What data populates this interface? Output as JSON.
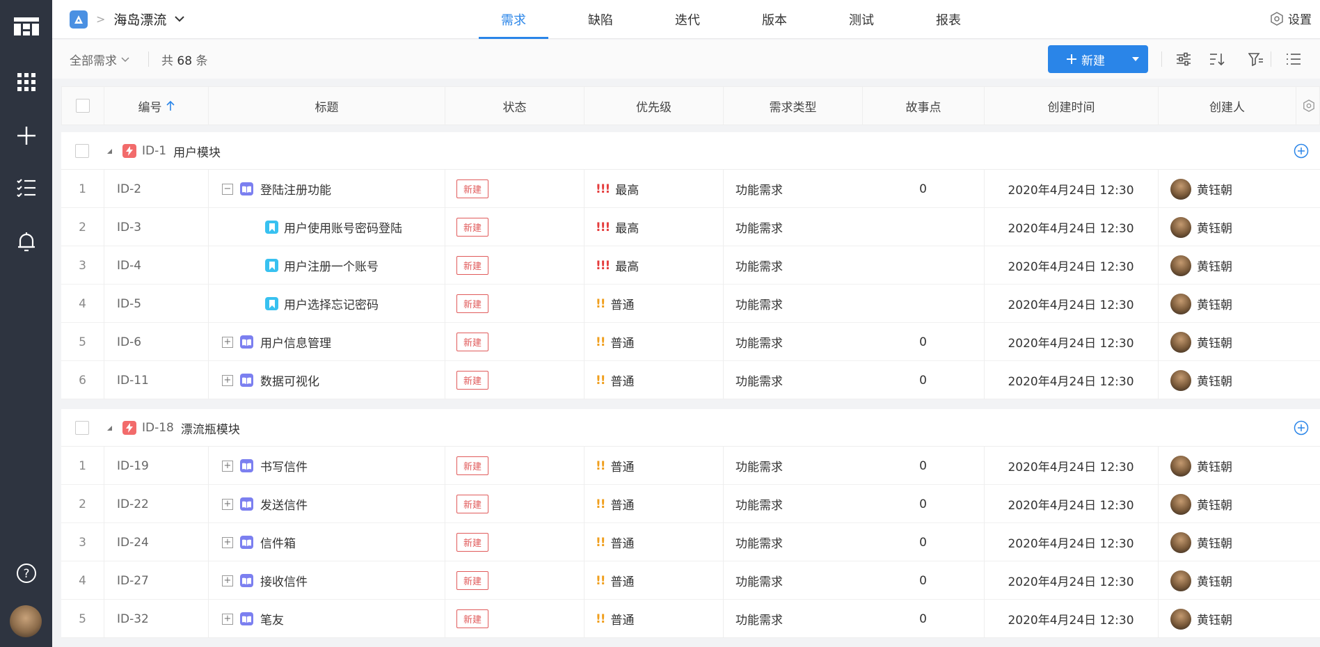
{
  "project": {
    "name": "海岛漂流"
  },
  "tabs": [
    {
      "label": "需求",
      "active": true
    },
    {
      "label": "缺陷",
      "active": false
    },
    {
      "label": "迭代",
      "active": false
    },
    {
      "label": "版本",
      "active": false
    },
    {
      "label": "测试",
      "active": false
    },
    {
      "label": "报表",
      "active": false
    }
  ],
  "settings_label": "设置",
  "toolbar": {
    "filter_label": "全部需求",
    "count_prefix": "共",
    "count_value": "68",
    "count_suffix": "条",
    "new_label": "新建"
  },
  "columns": {
    "id": "编号",
    "title": "标题",
    "status": "状态",
    "priority": "优先级",
    "type": "需求类型",
    "points": "故事点",
    "created": "创建时间",
    "creator": "创建人"
  },
  "groups": [
    {
      "id": "ID-1",
      "name": "用户模块",
      "rows": [
        {
          "idx": "1",
          "code": "ID-2",
          "title": "登陆注册功能",
          "kind": "story",
          "expander": "−",
          "indent": false,
          "status": "新建",
          "priority": "最高",
          "prio_level": "high",
          "type": "功能需求",
          "points": "0",
          "created": "2020年4月24日 12:30",
          "creator": "黄钰朝"
        },
        {
          "idx": "2",
          "code": "ID-3",
          "title": "用户使用账号密码登陆",
          "kind": "task",
          "expander": "",
          "indent": true,
          "status": "新建",
          "priority": "最高",
          "prio_level": "high",
          "type": "功能需求",
          "points": "",
          "created": "2020年4月24日 12:30",
          "creator": "黄钰朝"
        },
        {
          "idx": "3",
          "code": "ID-4",
          "title": "用户注册一个账号",
          "kind": "task",
          "expander": "",
          "indent": true,
          "status": "新建",
          "priority": "最高",
          "prio_level": "high",
          "type": "功能需求",
          "points": "",
          "created": "2020年4月24日 12:30",
          "creator": "黄钰朝"
        },
        {
          "idx": "4",
          "code": "ID-5",
          "title": "用户选择忘记密码",
          "kind": "task",
          "expander": "",
          "indent": true,
          "status": "新建",
          "priority": "普通",
          "prio_level": "mid",
          "type": "功能需求",
          "points": "",
          "created": "2020年4月24日 12:30",
          "creator": "黄钰朝"
        },
        {
          "idx": "5",
          "code": "ID-6",
          "title": "用户信息管理",
          "kind": "story",
          "expander": "+",
          "indent": false,
          "status": "新建",
          "priority": "普通",
          "prio_level": "mid",
          "type": "功能需求",
          "points": "0",
          "created": "2020年4月24日 12:30",
          "creator": "黄钰朝"
        },
        {
          "idx": "6",
          "code": "ID-11",
          "title": "数据可视化",
          "kind": "story",
          "expander": "+",
          "indent": false,
          "status": "新建",
          "priority": "普通",
          "prio_level": "mid",
          "type": "功能需求",
          "points": "0",
          "created": "2020年4月24日 12:30",
          "creator": "黄钰朝"
        }
      ]
    },
    {
      "id": "ID-18",
      "name": "漂流瓶模块",
      "rows": [
        {
          "idx": "1",
          "code": "ID-19",
          "title": "书写信件",
          "kind": "story",
          "expander": "+",
          "indent": false,
          "status": "新建",
          "priority": "普通",
          "prio_level": "mid",
          "type": "功能需求",
          "points": "0",
          "created": "2020年4月24日 12:30",
          "creator": "黄钰朝"
        },
        {
          "idx": "2",
          "code": "ID-22",
          "title": "发送信件",
          "kind": "story",
          "expander": "+",
          "indent": false,
          "status": "新建",
          "priority": "普通",
          "prio_level": "mid",
          "type": "功能需求",
          "points": "0",
          "created": "2020年4月24日 12:30",
          "creator": "黄钰朝"
        },
        {
          "idx": "3",
          "code": "ID-24",
          "title": "信件箱",
          "kind": "story",
          "expander": "+",
          "indent": false,
          "status": "新建",
          "priority": "普通",
          "prio_level": "mid",
          "type": "功能需求",
          "points": "0",
          "created": "2020年4月24日 12:30",
          "creator": "黄钰朝"
        },
        {
          "idx": "4",
          "code": "ID-27",
          "title": "接收信件",
          "kind": "story",
          "expander": "+",
          "indent": false,
          "status": "新建",
          "priority": "普通",
          "prio_level": "mid",
          "type": "功能需求",
          "points": "0",
          "created": "2020年4月24日 12:30",
          "creator": "黄钰朝"
        },
        {
          "idx": "5",
          "code": "ID-32",
          "title": "笔友",
          "kind": "story",
          "expander": "+",
          "indent": false,
          "status": "新建",
          "priority": "普通",
          "prio_level": "mid",
          "type": "功能需求",
          "points": "0",
          "created": "2020年4月24日 12:30",
          "creator": "黄钰朝"
        }
      ]
    }
  ],
  "colors": {
    "accent": "#2a85e8",
    "rail": "#2e3440",
    "status": "#e05a5a",
    "prio_high": "#e53e3e",
    "prio_mid": "#f0a020"
  }
}
